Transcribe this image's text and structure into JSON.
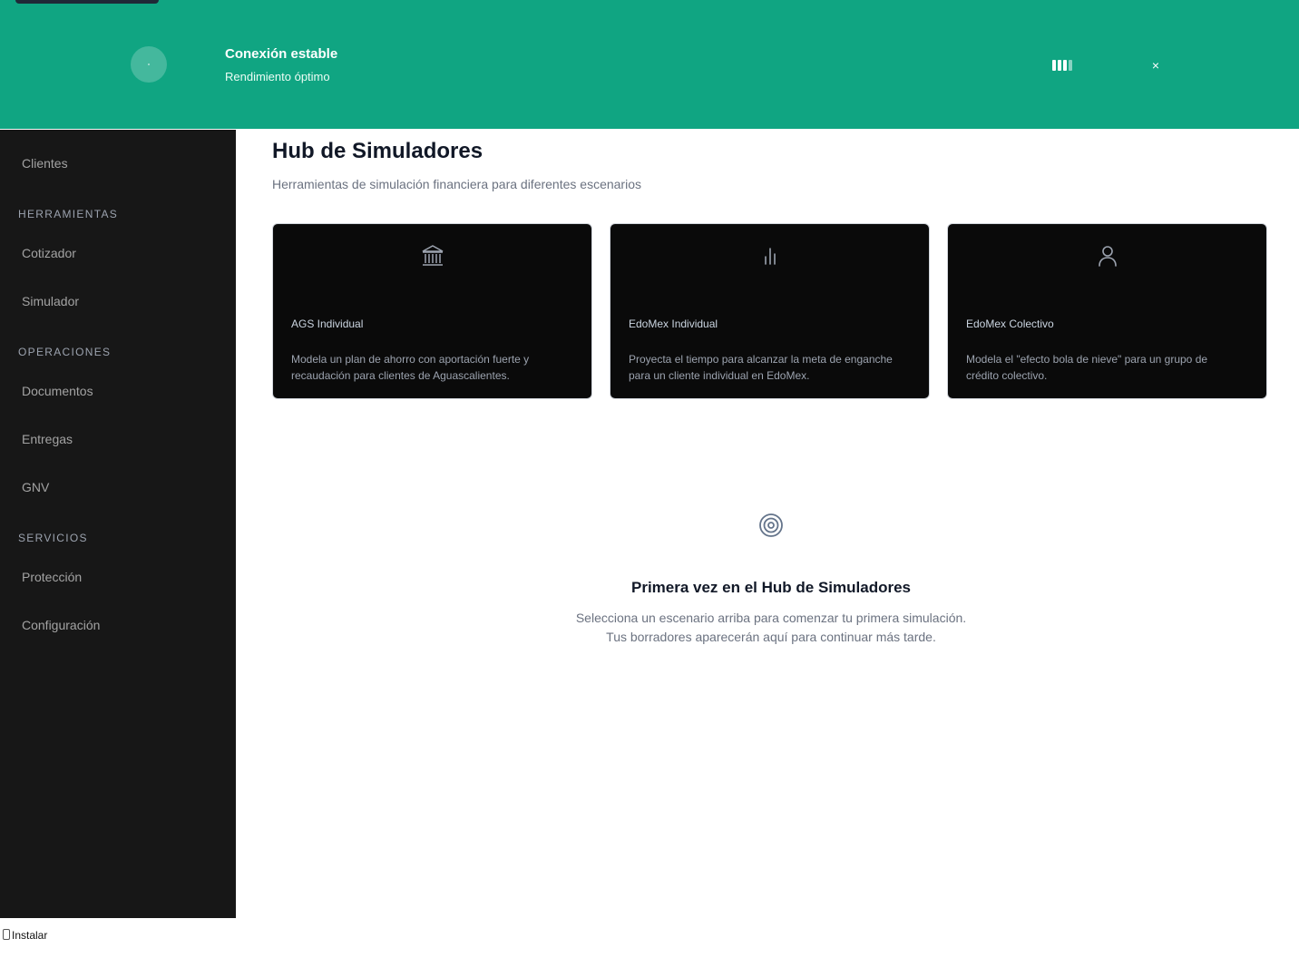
{
  "banner": {
    "title": "Conexión estable",
    "subtitle": "Rendimiento óptimo",
    "close_label": "×",
    "signal_bars_active": 3,
    "signal_bars_total": 4,
    "color": "#10a582"
  },
  "sidebar": {
    "items": [
      {
        "type": "item",
        "label": "Clientes"
      },
      {
        "type": "section",
        "label": "HERRAMIENTAS"
      },
      {
        "type": "item",
        "label": "Cotizador"
      },
      {
        "type": "item",
        "label": "Simulador"
      },
      {
        "type": "section",
        "label": "OPERACIONES"
      },
      {
        "type": "item",
        "label": "Documentos"
      },
      {
        "type": "item",
        "label": "Entregas"
      },
      {
        "type": "item",
        "label": "GNV"
      },
      {
        "type": "section",
        "label": "SERVICIOS"
      },
      {
        "type": "item",
        "label": "Protección"
      },
      {
        "type": "item",
        "label": "Configuración"
      }
    ]
  },
  "main": {
    "title": "Hub de Simuladores",
    "subtitle": "Herramientas de simulación financiera para diferentes escenarios",
    "cards": [
      {
        "icon": "bank-icon",
        "title": "AGS Individual",
        "description": "Modela un plan de ahorro con aportación fuerte y recaudación para clientes de Aguascalientes."
      },
      {
        "icon": "bar-chart-icon",
        "title": "EdoMex Individual",
        "description": "Proyecta el tiempo para alcanzar la meta de enganche para un cliente individual en EdoMex."
      },
      {
        "icon": "user-icon",
        "title": "EdoMex Colectivo",
        "description": "Modela el \"efecto bola de nieve\" para un grupo de crédito colectivo."
      }
    ],
    "empty_state": {
      "icon": "target-icon",
      "title": "Primera vez en el Hub de Simuladores",
      "line1": "Selecciona un escenario arriba para comenzar tu primera simulación.",
      "line2": "Tus borradores aparecerán aquí para continuar más tarde."
    }
  },
  "footer": {
    "install_label": "Instalar"
  }
}
